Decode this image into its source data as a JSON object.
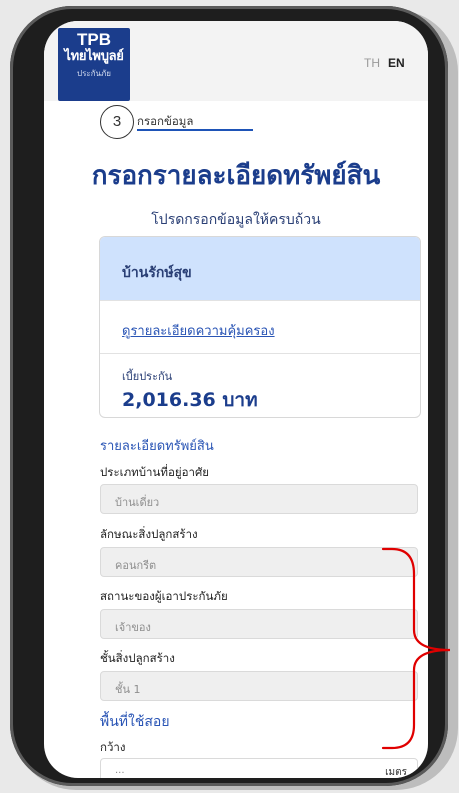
{
  "header": {
    "logo": {
      "line1": "TPB",
      "line2": "ไทยไพบูลย์",
      "line3": "ประกันภัย"
    },
    "lang_th": "TH",
    "lang_en": "EN"
  },
  "step": {
    "number": "3",
    "label": "กรอกข้อมูล"
  },
  "page_title": "กรอกรายละเอียดทรัพย์สิน",
  "page_subtitle": "โปรดกรอกข้อมูลให้ครบถ้วน",
  "plan_card": {
    "name": "บ้านรักษ์สุข",
    "coverage_link": "ดูรายละเอียดความคุ้มครอง",
    "premium_label": "เบี้ยประกัน",
    "premium_value": "2,016.36 บาท"
  },
  "asset_section": {
    "title": "รายละเอียดทรัพย์สิน",
    "fields": [
      {
        "label": "ประเภทบ้านที่อยู่อาศัย",
        "value": "บ้านเดี่ยว"
      },
      {
        "label": "ลักษณะสิ่งปลูกสร้าง",
        "value": "คอนกรีต"
      },
      {
        "label": "สถานะของผู้เอาประกันภัย",
        "value": "เจ้าของ"
      },
      {
        "label": "ชั้นสิ่งปลูกสร้าง",
        "value": "ชั้น 1"
      }
    ]
  },
  "area_section": {
    "title": "พื้นที่ใช้สอย",
    "width_label": "กว้าง",
    "width_value_partial": "...",
    "width_unit_partial": "เมตร"
  },
  "colors": {
    "brand_navy": "#1b3d8c",
    "link_blue": "#2a55b5",
    "card_header": "#cfe2fd",
    "annotation_red": "#e00000"
  }
}
